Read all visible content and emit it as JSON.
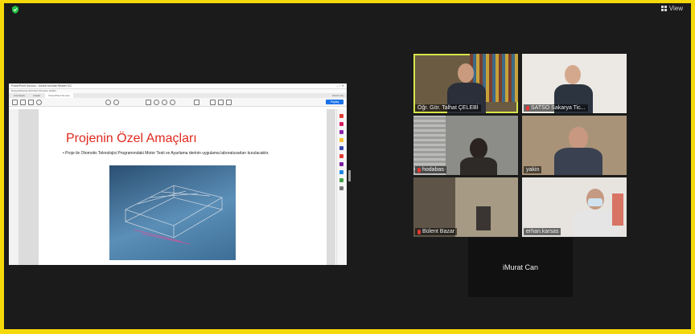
{
  "top_bar": {
    "view_label": "View"
  },
  "shared_window": {
    "title": "PowerPoint Sunusu - Adobe Acrobat Reader DC",
    "menu": "Dosya  Düzenle  Görünüm  Pencere  Yardım",
    "tabs": [
      "Ana Sayfa",
      "Araçlar",
      "PowerPoint Sunusu"
    ],
    "tabs_right": "Oturum Aç",
    "share_button": "Paylaş",
    "slide_title": "Projenin Özel Amaçları",
    "slide_bullet": "Proje ile Otomotiv Teknolojisi Programındaki Motor Testi ve Ayarlama derinin uygulama laboratuvarları kurulacaktır."
  },
  "participants": [
    {
      "name": "Öğr. Gör. Talhat ÇELEBİ",
      "muted": false,
      "active": true
    },
    {
      "name": "SATSO Sakarya Tic...",
      "muted": true,
      "active": false
    },
    {
      "name": "hodabas",
      "muted": true,
      "active": false
    },
    {
      "name": "yakin",
      "muted": false,
      "active": false
    },
    {
      "name": "Bülent Bazar",
      "muted": true,
      "active": false
    },
    {
      "name": "erhan.karsas",
      "muted": false,
      "active": false
    }
  ],
  "name_only_tile": {
    "name": "iMurat Can"
  },
  "colors": {
    "border": "#f5d90a",
    "background": "#1b1b1b",
    "active_speaker": "#d6e64a",
    "muted": "#e53935",
    "slide_title": "#e0291d"
  }
}
